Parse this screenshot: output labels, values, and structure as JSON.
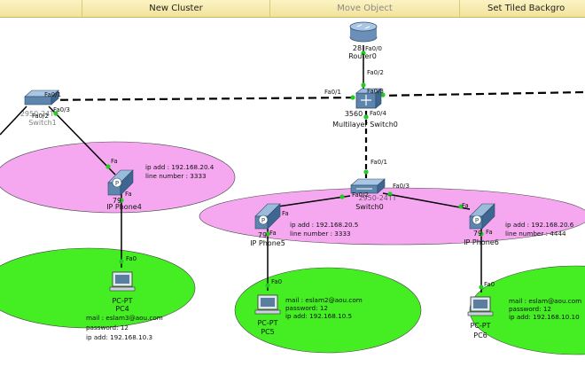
{
  "toolbar": {
    "new_cluster": "New Cluster",
    "move_object": "Move Object",
    "set_tiled_background": "Set Tiled Backgro"
  },
  "devices": {
    "router0": {
      "model": "28",
      "name": "Router0"
    },
    "mls0": {
      "model": "3560",
      "name": "Multilayer Switch0"
    },
    "switch1": {
      "model": "2950-24T",
      "name": "Switch1"
    },
    "switch0": {
      "model": "2950-24TT",
      "name": "Switch0"
    },
    "ipphone4": {
      "model": "79",
      "name": "IP Phone4"
    },
    "ipphone5": {
      "model": "79",
      "name": "IP Phone5"
    },
    "ipphone6": {
      "model": "79",
      "name": "IP Phone6"
    },
    "pc4": {
      "type": "PC-PT",
      "name": "PC4"
    },
    "pc5": {
      "type": "PC-PT",
      "name": "PC5"
    },
    "pc6": {
      "type": "PC-PT",
      "name": "PC6"
    }
  },
  "ports": {
    "router_fa00": "Fa0/0",
    "mls_fa02": "Fa0/2",
    "mls_fa01": "Fa0/1",
    "mls_fa03": "Fa0/3",
    "mls_fa04": "Fa0/4",
    "sw1_fa01": "Fa0/1",
    "sw1_fa03": "Fa0/3",
    "sw1_fa02": "Fa0/2",
    "sw0_fa01": "Fa0/1",
    "sw0_fa02": "Fa0/2",
    "sw0_fa03": "Fa0/3",
    "phone4_fa_top": "Fa",
    "phone4_fa_bot": "Fa",
    "phone5_fa_top": "Fa",
    "phone5_fa_bot": "Fa",
    "phone6_fa_top": "Fa",
    "phone6_fa_bot": "Fa",
    "pc4_fa0": "Fa0",
    "pc5_fa0": "Fa0",
    "pc6_fa0": "Fa0"
  },
  "notes": {
    "phone4": [
      "ip add : 192.168.20.4",
      "line number : 3333"
    ],
    "phone5": [
      "ip add : 192.168.20.5",
      "line number : 3333"
    ],
    "phone6": [
      "ip add : 192.168.20.6",
      "line number : 4444"
    ],
    "pc4": [
      "mail : eslam3@aou.com",
      "password: 12",
      "ip add: 192.168.10.3"
    ],
    "pc5": [
      "mail : eslam2@aou.com",
      "password: 12",
      "ip add: 192.168.10.5"
    ],
    "pc6": [
      "mail : eslam@aou.com",
      "password: 12",
      "ip add: 192.168.10.10"
    ]
  },
  "colors": {
    "voice_cluster": "#f5a8f0",
    "data_cluster": "#44ee22",
    "link": "#000000",
    "link_up": "#22cc22"
  }
}
